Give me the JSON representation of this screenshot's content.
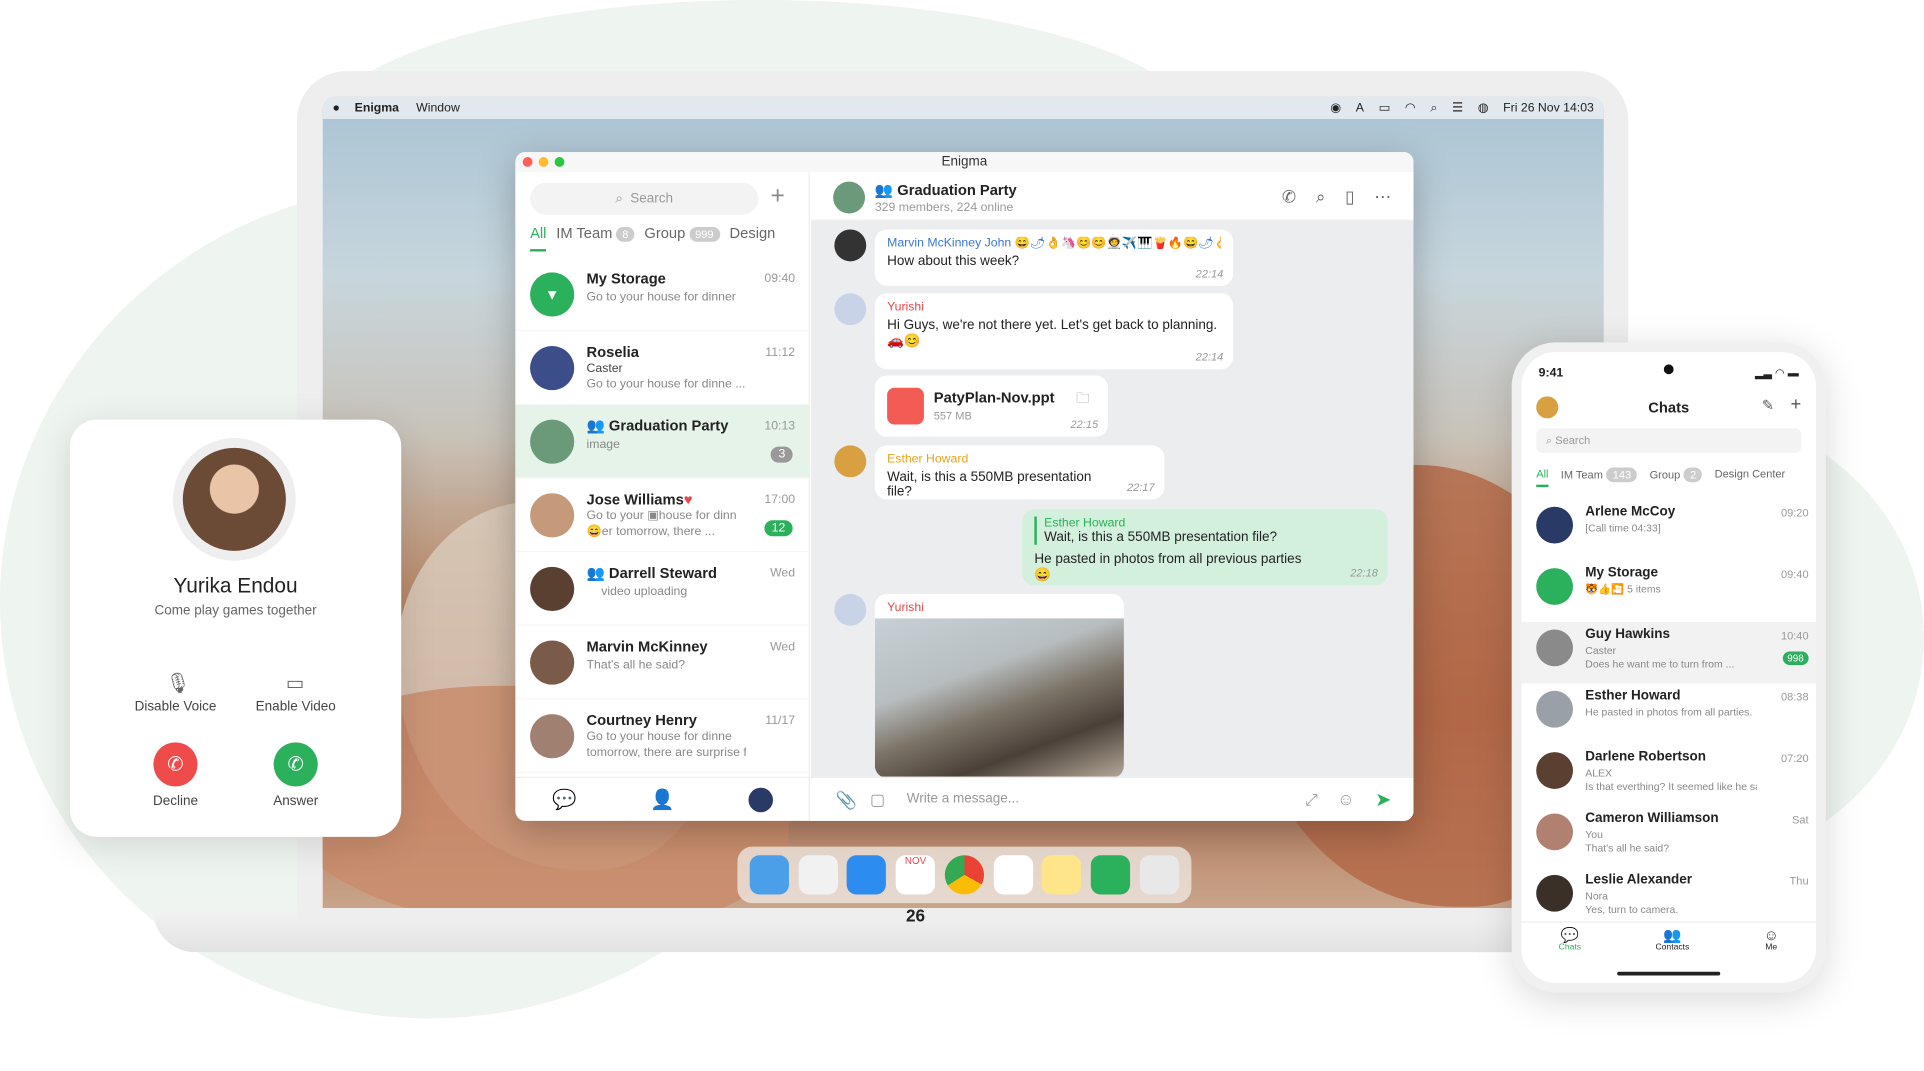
{
  "menubar": {
    "app": "Enigma",
    "window": "Window",
    "date": "Fri 26 Nov  14:03"
  },
  "window": {
    "title": "Enigma"
  },
  "left": {
    "search": "Search",
    "tabs": [
      {
        "label": "All"
      },
      {
        "label": "IM Team",
        "badge": "8"
      },
      {
        "label": "Group",
        "badge": "999"
      },
      {
        "label": "Design"
      }
    ],
    "chats": [
      {
        "name": "My Storage",
        "time": "09:40",
        "line1": "Go to your house for dinner",
        "line2": ""
      },
      {
        "name": "Roselia",
        "time": "11:12",
        "line1": "Caster",
        "line2": "Go to your house for dinne ..."
      },
      {
        "name": "Graduation Party",
        "time": "10:13",
        "line1": "image",
        "line2": "",
        "count": "3"
      },
      {
        "name": "Jose Williams",
        "time": "17:00",
        "line1": "Go to your ▣house for dinn",
        "line2": "😄er tomorrow, there ...",
        "count": "12"
      },
      {
        "name": "Darrell Steward",
        "time": "Wed",
        "line1": "video uploading",
        "line2": ""
      },
      {
        "name": "Marvin McKinney",
        "time": "Wed",
        "line1": "That's all he said?",
        "line2": ""
      },
      {
        "name": "Courtney Henry",
        "time": "11/17",
        "line1": "Go to your house for dinne",
        "line2": "tomorrow, there are surprise for ..."
      }
    ]
  },
  "chat": {
    "title": "Graduation Party",
    "subtitle": "329 members, 224 online",
    "messages": [
      {
        "who": "Marvin McKinney John 😄🌶👌🦄😊😊🧑‍🚀✈️🎹🍟🔥😄🌶👌🧑‍🚀✈️...",
        "text": "How about this week?",
        "time": "22:14"
      },
      {
        "who": "Yurishi",
        "text": "Hi Guys, we're not there yet. Let's get back to planning.",
        "text2": "🚗😊",
        "time": "22:14"
      },
      {
        "file": "PatyPlan-Nov.ppt",
        "size": "557 MB",
        "time": "22:15"
      },
      {
        "who": "Esther Howard",
        "text": "Wait, is this a 550MB presentation file?",
        "time": "22:17"
      },
      {
        "quote_who": "Esther Howard",
        "quote": "Wait, is this a 550MB presentation file?",
        "text": "He pasted in photos from all previous parties 😄",
        "time": "22:18"
      },
      {
        "who": "Yurishi"
      }
    ],
    "composer": "Write a message..."
  },
  "call": {
    "name": "Yurika Endou",
    "status": "Come play games together",
    "voice": "Disable Voice",
    "video": "Enable Video",
    "decline": "Decline",
    "answer": "Answer"
  },
  "phone": {
    "time": "9:41",
    "title": "Chats",
    "search": "Search",
    "tabs": [
      {
        "label": "All"
      },
      {
        "label": "IM Team",
        "badge": "143"
      },
      {
        "label": "Group",
        "badge": "2"
      },
      {
        "label": "Design Center"
      }
    ],
    "chats": [
      {
        "name": "Arlene McCoy",
        "time": "09:20",
        "line1": "[Call time 04:33]",
        "line2": ""
      },
      {
        "name": "My Storage",
        "time": "09:40",
        "line1": "🐯👍🎦 5 items",
        "line2": ""
      },
      {
        "name": "Guy Hawkins",
        "time": "10:40",
        "line1": "Caster",
        "line2": "Does he want me to turn from ...",
        "count": "998"
      },
      {
        "name": "Esther Howard",
        "time": "08:38",
        "line1": "He pasted in photos from all parties.",
        "line2": ""
      },
      {
        "name": "Darlene Robertson",
        "time": "07:20",
        "line1": "ALEX",
        "line2": "Is that everthing? It seemed like he said ..."
      },
      {
        "name": "Cameron Williamson",
        "time": "Sat",
        "line1": "You",
        "line2": "That's all he said?"
      },
      {
        "name": "Leslie Alexander",
        "time": "Thu",
        "line1": "Nora",
        "line2": "Yes, turn to camera."
      }
    ],
    "nav": {
      "chats": "Chats",
      "contacts": "Contacts",
      "me": "Me"
    }
  },
  "dock": {
    "calendar_month": "NOV",
    "calendar_day": "26"
  },
  "colors": {
    "accent": "#2bb05c",
    "decline": "#f04b4b",
    "name_blue": "#3a76d8",
    "name_red": "#e5484d",
    "name_orange": "#e8a21c"
  }
}
